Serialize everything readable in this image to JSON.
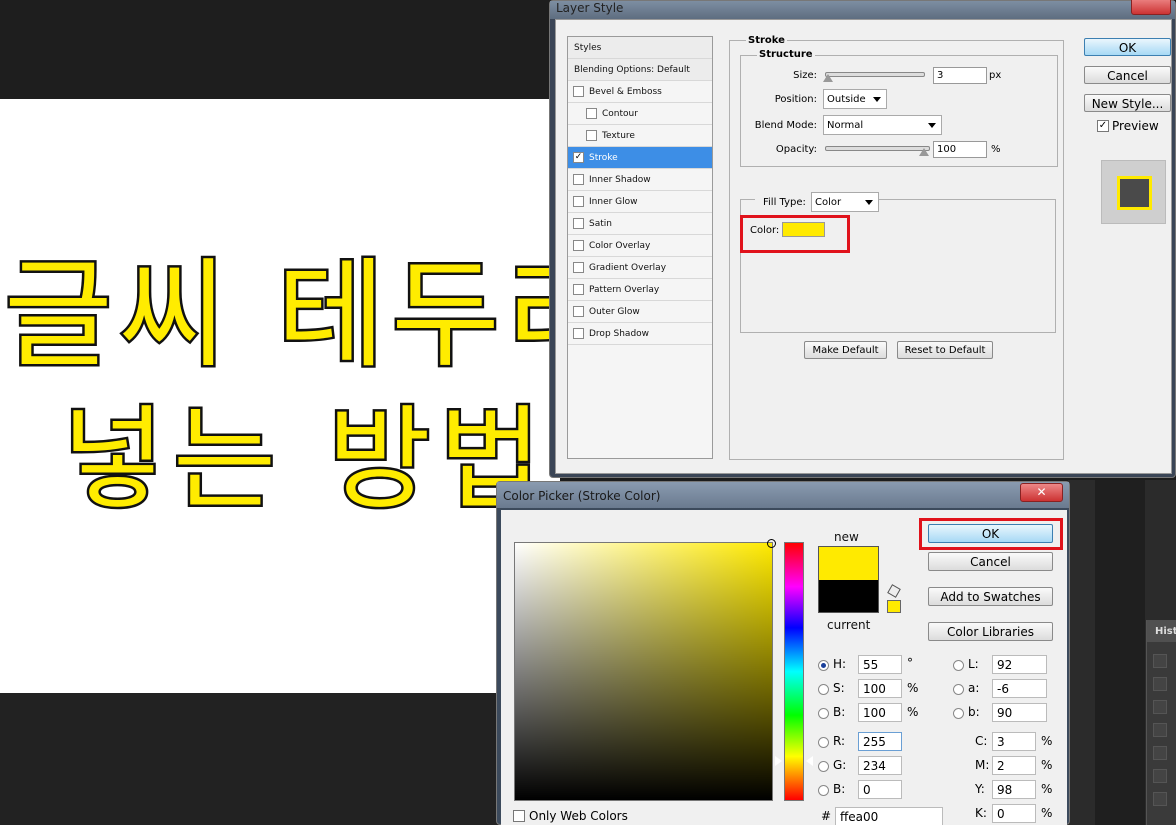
{
  "canvas": {
    "line1": "글씨 테두리",
    "line2": "넣는 방법"
  },
  "history_panel": {
    "tab_label": "Histo"
  },
  "layer_style": {
    "title": "Layer Style",
    "styles_list": [
      {
        "label": "Styles",
        "type": "header"
      },
      {
        "label": "Blending Options: Default",
        "type": "header"
      },
      {
        "label": "Bevel & Emboss",
        "checked": false
      },
      {
        "label": "Contour",
        "checked": false,
        "indent": true
      },
      {
        "label": "Texture",
        "checked": false,
        "indent": true
      },
      {
        "label": "Stroke",
        "checked": true,
        "selected": true
      },
      {
        "label": "Inner Shadow",
        "checked": false
      },
      {
        "label": "Inner Glow",
        "checked": false
      },
      {
        "label": "Satin",
        "checked": false
      },
      {
        "label": "Color Overlay",
        "checked": false
      },
      {
        "label": "Gradient Overlay",
        "checked": false
      },
      {
        "label": "Pattern Overlay",
        "checked": false
      },
      {
        "label": "Outer Glow",
        "checked": false
      },
      {
        "label": "Drop Shadow",
        "checked": false
      }
    ],
    "stroke": {
      "group_title": "Stroke",
      "structure_title": "Structure",
      "size_label": "Size:",
      "size_value": "3",
      "size_unit": "px",
      "position_label": "Position:",
      "position_value": "Outside",
      "blend_label": "Blend Mode:",
      "blend_value": "Normal",
      "opacity_label": "Opacity:",
      "opacity_value": "100",
      "opacity_unit": "%",
      "filltype_label": "Fill Type:",
      "filltype_value": "Color",
      "color_label": "Color:",
      "color_hex": "#ffea00",
      "make_default": "Make Default",
      "reset_default": "Reset to Default"
    },
    "buttons": {
      "ok": "OK",
      "cancel": "Cancel",
      "new_style": "New Style...",
      "preview": "Preview"
    },
    "preview_checked": true
  },
  "color_picker": {
    "title": "Color Picker (Stroke Color)",
    "close": "✕",
    "new_label": "new",
    "current_label": "current",
    "new_color": "#ffea00",
    "current_color": "#000000",
    "buttons": {
      "ok": "OK",
      "cancel": "Cancel",
      "add_swatches": "Add to Swatches",
      "color_libraries": "Color Libraries"
    },
    "fields": {
      "H": {
        "label": "H:",
        "value": "55",
        "unit": "°"
      },
      "S": {
        "label": "S:",
        "value": "100",
        "unit": "%"
      },
      "B": {
        "label": "B:",
        "value": "100",
        "unit": "%"
      },
      "R": {
        "label": "R:",
        "value": "255"
      },
      "G": {
        "label": "G:",
        "value": "234"
      },
      "Bl": {
        "label": "B:",
        "value": "0"
      },
      "L": {
        "label": "L:",
        "value": "92"
      },
      "a": {
        "label": "a:",
        "value": "-6"
      },
      "b": {
        "label": "b:",
        "value": "90"
      },
      "C": {
        "label": "C:",
        "value": "3",
        "unit": "%"
      },
      "M": {
        "label": "M:",
        "value": "2",
        "unit": "%"
      },
      "Y": {
        "label": "Y:",
        "value": "98",
        "unit": "%"
      },
      "K": {
        "label": "K:",
        "value": "0",
        "unit": "%"
      }
    },
    "hex_label": "#",
    "hex_value": "ffea00",
    "only_web_colors": "Only Web Colors"
  }
}
